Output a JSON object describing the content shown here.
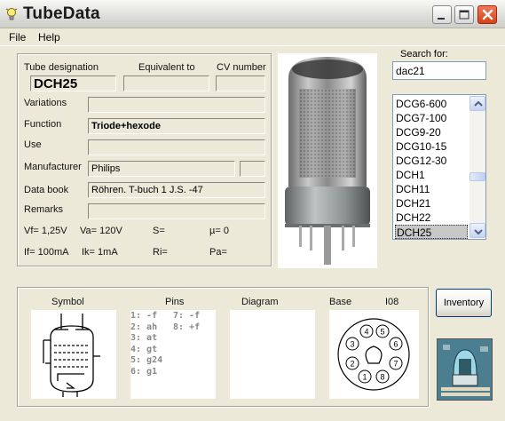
{
  "window": {
    "title": "TubeData"
  },
  "menu": {
    "file": "File",
    "help": "Help"
  },
  "details": {
    "tube_designation_label": "Tube designation",
    "equivalent_label": "Equivalent to",
    "cv_label": "CV number",
    "tube_designation": "DCH25",
    "equivalent": "",
    "cv_number": "",
    "variations_label": "Variations",
    "variations": "",
    "function_label": "Function",
    "function": "Triode+hexode",
    "use_label": "Use",
    "use": "",
    "manufacturer_label": "Manufacturer",
    "manufacturer": "Philips",
    "manufacturer_extra": "",
    "databook_label": "Data book",
    "databook": "Röhren. T-buch 1 J.S. -47",
    "remarks_label": "Remarks",
    "remarks": "",
    "vf": "Vf= 1,25V",
    "va": "Va= 120V",
    "s": "S=",
    "mu": "µ=    0",
    "if": "If= 100mA",
    "ik": "Ik=  1mA",
    "ri": "Ri=",
    "pa": "Pa="
  },
  "search": {
    "label": "Search for:",
    "value": "dac21",
    "items": [
      "DCG6-600",
      "DCG7-100",
      "DCG9-20",
      "DCG10-15",
      "DCG12-30",
      "DCH1",
      "DCH11",
      "DCH21",
      "DCH22",
      "DCH25"
    ],
    "selected": "DCH25"
  },
  "bottom": {
    "symbol_label": "Symbol",
    "pins_label": "Pins",
    "diagram_label": "Diagram",
    "base_label": "Base",
    "base_type": "I08",
    "pins_left": [
      "1: -f",
      "2: ah",
      "3: at",
      "4: gt",
      "5: g24",
      "6: g1"
    ],
    "pins_right": [
      "7: -f",
      "8: +f"
    ],
    "base_pins": [
      "1",
      "2",
      "3",
      "4",
      "5",
      "6",
      "7",
      "8"
    ]
  },
  "buttons": {
    "inventory": "Inventory"
  },
  "colors": {
    "close": "#d64218",
    "selection": "#c8c8c8",
    "field_bg": "#ece9d8"
  },
  "icons": {
    "app": "lightbulb-icon",
    "minimize": "minimize-icon",
    "maximize": "maximize-icon",
    "close": "close-icon"
  }
}
